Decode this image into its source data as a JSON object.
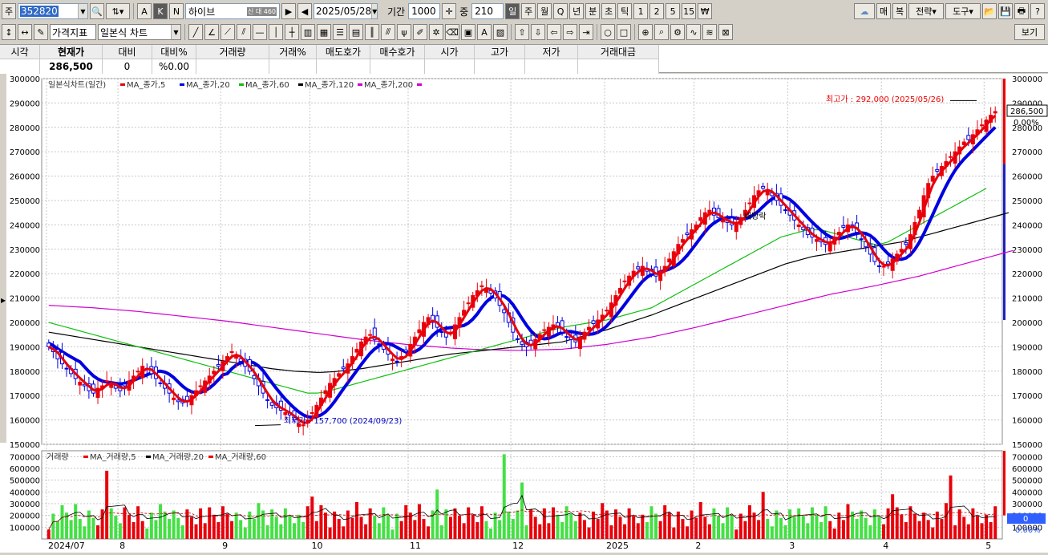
{
  "toolbar1": {
    "market_label": "주",
    "code": "352820",
    "mode_a": "A",
    "mode_k": "K",
    "mode_n": "N",
    "stock_name": "하이브",
    "name_badges": "신 대 460",
    "date": "2025/05/28",
    "period_label": "기간",
    "period_value": "1000",
    "count_label": "중",
    "count_value": "210",
    "periods": [
      "일",
      "주",
      "월",
      "Q",
      "년",
      "분",
      "초",
      "틱",
      "1",
      "2",
      "5",
      "15",
      "₩"
    ],
    "right_buttons": [
      "매",
      "복",
      "전략",
      "도구"
    ],
    "bogi": "보기"
  },
  "toolbar2": {
    "indicator_select": "가격지표",
    "chart_type_select": "일본식 차트"
  },
  "quote": {
    "headers": [
      "시각",
      "현재가",
      "대비",
      "대비%",
      "거래량",
      "거래%",
      "매도호가",
      "매수호가",
      "시가",
      "고가",
      "저가",
      "거래대금"
    ],
    "values": [
      "",
      "286,500",
      "0",
      "%0.00",
      "",
      "",
      "",
      "",
      "",
      "",
      "",
      ""
    ]
  },
  "chart_data": [
    {
      "type": "candlestick",
      "title": "일본식차트(일간)",
      "legend": [
        "MA_종가,5",
        "MA_종가,20",
        "MA_종가,60",
        "MA_종가,120",
        "MA_종가,200"
      ],
      "colors": {
        "up": "#e8000b",
        "down": "#0000e0",
        "ma5": "#e8000b",
        "ma20": "#0000e0",
        "ma60": "#10c010",
        "ma120": "#000000",
        "ma200": "#d000d0"
      },
      "ylim": [
        150000,
        300000
      ],
      "yticks": [
        "150000",
        "160000",
        "170000",
        "180000",
        "190000",
        "200000",
        "210000",
        "220000",
        "230000",
        "240000",
        "250000",
        "260000",
        "270000",
        "280000",
        "290000",
        "300000"
      ],
      "xticks": [
        {
          "label": "2024/07",
          "x": 0
        },
        {
          "label": "8",
          "x": 16
        },
        {
          "label": "9",
          "x": 39
        },
        {
          "label": "10",
          "x": 59
        },
        {
          "label": "11",
          "x": 81
        },
        {
          "label": "12",
          "x": 104
        },
        {
          "label": "2025",
          "x": 125
        },
        {
          "label": "2",
          "x": 145
        },
        {
          "label": "3",
          "x": 166
        },
        {
          "label": "4",
          "x": 187
        },
        {
          "label": "5",
          "x": 210
        }
      ],
      "current_price": "286,500",
      "current_pct": "0.00%",
      "max_label": "최고가 : 292,000 (2025/05/26)",
      "min_label": "최저가 : 157,700 (2024/09/23)",
      "annotation": "배당락",
      "close": [
        190000,
        188000,
        185000,
        183000,
        181000,
        179000,
        177000,
        175500,
        174000,
        172000,
        171000,
        173000,
        174000,
        176000,
        175000,
        173000,
        172000,
        174000,
        176000,
        178000,
        180000,
        182000,
        181000,
        179000,
        177000,
        175000,
        173000,
        171000,
        169000,
        167500,
        167000,
        168000,
        170000,
        172000,
        174000,
        176000,
        178000,
        180000,
        182000,
        184000,
        186000,
        188000,
        186000,
        184000,
        182000,
        180000,
        177000,
        174000,
        171000,
        168000,
        166000,
        165000,
        164000,
        163000,
        162000,
        160000,
        158500,
        158000,
        160000,
        163000,
        166000,
        169000,
        172000,
        175000,
        177000,
        179000,
        181000,
        183000,
        186000,
        189000,
        192000,
        194000,
        195000,
        193000,
        191000,
        189000,
        187000,
        185000,
        184000,
        186000,
        188000,
        191000,
        194000,
        197000,
        200000,
        202000,
        200000,
        198000,
        196000,
        194000,
        196000,
        199000,
        202000,
        205000,
        208000,
        211000,
        213000,
        215000,
        214000,
        212000,
        210000,
        207000,
        204000,
        200000,
        196000,
        193000,
        191000,
        190000,
        191000,
        193000,
        195000,
        197000,
        198000,
        199000,
        198000,
        196000,
        194000,
        193000,
        192000,
        194000,
        196000,
        198000,
        199500,
        201000,
        203000,
        205000,
        208000,
        211000,
        214000,
        217000,
        219000,
        221000,
        222000,
        223000,
        221000,
        220000,
        219000,
        221000,
        223000,
        226000,
        229000,
        232000,
        234000,
        236000,
        238000,
        240000,
        243000,
        245000,
        246000,
        244000,
        243000,
        242000,
        241000,
        240000,
        241000,
        243000,
        246000,
        249000,
        252000,
        254000,
        255000,
        254000,
        252000,
        250000,
        248000,
        246000,
        244000,
        242000,
        240000,
        238000,
        236000,
        235000,
        234000,
        233000,
        232000,
        233000,
        235000,
        237000,
        239000,
        240000,
        239000,
        237000,
        234000,
        231000,
        228000,
        225000,
        223000,
        223000,
        224000,
        226000,
        228000,
        230000,
        232000,
        236000,
        241000,
        246000,
        252000,
        257000,
        260000,
        262000,
        264000,
        266000,
        268000,
        270000,
        272000,
        274000,
        275000,
        277000,
        279000,
        281000,
        283000,
        285000,
        286500
      ],
      "ma60": [
        200000,
        199500,
        199000,
        198500,
        198000,
        197500,
        197000,
        196500,
        196000,
        195500,
        195000,
        194500,
        194000,
        193500,
        193000,
        192500,
        192000,
        191500,
        191000,
        190500,
        190000,
        189500,
        189000,
        188500,
        188000,
        187500,
        187000,
        186500,
        186000,
        185500,
        185000,
        184500,
        184000,
        183500,
        183000,
        182500,
        182000,
        181500,
        181000,
        180500,
        180000,
        179500,
        179000,
        178500,
        178000,
        177500,
        177000,
        176500,
        176000,
        175500,
        175000,
        174500,
        174000,
        173500,
        173000,
        172500,
        172000,
        171500,
        171000,
        171000,
        171000,
        171200,
        171500,
        172000,
        172500,
        173000,
        173500,
        174000,
        174500,
        175000,
        175500,
        176000,
        176500,
        177000,
        177500,
        178000,
        178500,
        179000,
        179500,
        180000,
        180500,
        181000,
        181500,
        182000,
        182500,
        183000,
        183500,
        184000,
        184500,
        185000,
        185500,
        186000,
        186500,
        187000,
        187500,
        188000,
        188500,
        189000,
        189500,
        190000,
        190500,
        191000,
        191500,
        192000,
        192500,
        193000,
        193500,
        194000,
        194500,
        195000,
        195500,
        196000,
        196500,
        197000,
        197500,
        198000,
        198300,
        198600,
        198900,
        199200,
        199500,
        199800,
        200100,
        200400,
        200700,
        201000,
        201500,
        202000,
        202500,
        203000,
        203500,
        204000,
        204500,
        205000,
        205500,
        206000,
        207000,
        208000,
        209000,
        210000,
        211000,
        212000,
        213000,
        214000,
        215000,
        216000,
        217000,
        218000,
        219000,
        220000,
        221000,
        222000,
        223000,
        224000,
        225000,
        226000,
        227000,
        228000,
        229000,
        230000,
        231000,
        232000,
        233000,
        234000,
        235000,
        235500,
        236000,
        236500,
        237000,
        237500,
        238000,
        238000,
        238000,
        238000,
        237500,
        237000,
        236500,
        236000,
        235500,
        235000,
        234500,
        234000,
        233500,
        233000,
        232500,
        232000,
        232000,
        232500,
        233000,
        234000,
        235000,
        236000,
        237000,
        238000,
        239000,
        240000,
        241000,
        242000,
        243000,
        244000,
        245000,
        246000,
        247000,
        248000,
        249000,
        250000,
        251000,
        252000,
        253000,
        254000,
        255000
      ],
      "ma120": [
        196000,
        195700,
        195400,
        195100,
        194800,
        194500,
        194200,
        193900,
        193600,
        193300,
        193000,
        192700,
        192400,
        192100,
        191800,
        191500,
        191200,
        190900,
        190600,
        190300,
        190000,
        189700,
        189400,
        189100,
        188800,
        188500,
        188200,
        187900,
        187600,
        187300,
        187000,
        186700,
        186400,
        186100,
        185800,
        185500,
        185200,
        184900,
        184600,
        184300,
        184000,
        183700,
        183400,
        183100,
        182800,
        182500,
        182200,
        181900,
        181600,
        181300,
        181000,
        180800,
        180600,
        180400,
        180200,
        180000,
        179900,
        179800,
        179700,
        179600,
        179500,
        179500,
        179600,
        179700,
        179800,
        180000,
        180200,
        180400,
        180600,
        180800,
        181000,
        181300,
        181600,
        181900,
        182200,
        182500,
        182800,
        183100,
        183400,
        183700,
        184000,
        184300,
        184600,
        184900,
        185200,
        185500,
        185800,
        186100,
        186400,
        186700,
        187000,
        187200,
        187400,
        187600,
        187800,
        188000,
        188200,
        188400,
        188600,
        188800,
        189000,
        189200,
        189400,
        189600,
        189800,
        190000,
        190200,
        190400,
        190600,
        190800,
        191000,
        191200,
        191400,
        191600,
        191800,
        192000,
        192500,
        193000,
        193500,
        194000,
        194500,
        195000,
        195500,
        196000,
        196500,
        197000,
        197600,
        198200,
        198800,
        199400,
        200000,
        200600,
        201200,
        201800,
        202400,
        203000,
        203700,
        204400,
        205100,
        205800,
        206500,
        207200,
        207900,
        208600,
        209300,
        210000,
        210700,
        211400,
        212100,
        212800,
        213500,
        214200,
        214900,
        215600,
        216300,
        217000,
        217700,
        218400,
        219100,
        219800,
        220500,
        221200,
        221900,
        222600,
        223300,
        224000,
        224500,
        225000,
        225500,
        226000,
        226500,
        227000,
        227300,
        227600,
        227900,
        228200,
        228500,
        228800,
        229100,
        229400,
        229700,
        230000,
        230300,
        230600,
        230900,
        231200,
        231500,
        231800,
        232100,
        232400,
        232700,
        233000,
        233500,
        234000,
        234500,
        235000,
        235500,
        236000,
        236500,
        237000,
        237500,
        238000,
        238500,
        239000,
        239500,
        240000,
        240500,
        241000,
        241500,
        242000,
        242500,
        243000,
        243500,
        244000,
        244500,
        245000
      ],
      "ma200": [
        207000,
        206900,
        206800,
        206700,
        206600,
        206500,
        206400,
        206300,
        206200,
        206100,
        206000,
        205850,
        205700,
        205550,
        205400,
        205250,
        205100,
        204950,
        204800,
        204650,
        204500,
        204300,
        204100,
        203900,
        203700,
        203500,
        203300,
        203100,
        202900,
        202700,
        202500,
        202300,
        202100,
        201900,
        201700,
        201500,
        201300,
        201100,
        200900,
        200700,
        200500,
        200250,
        200000,
        199750,
        199500,
        199250,
        199000,
        198750,
        198500,
        198250,
        198000,
        197750,
        197500,
        197250,
        197000,
        196750,
        196500,
        196250,
        196000,
        195750,
        195500,
        195250,
        195000,
        194750,
        194500,
        194250,
        194000,
        193750,
        193500,
        193250,
        193000,
        192800,
        192600,
        192400,
        192200,
        192000,
        191800,
        191600,
        191400,
        191200,
        191000,
        190850,
        190700,
        190550,
        190400,
        190250,
        190100,
        189950,
        189800,
        189650,
        189500,
        189400,
        189300,
        189200,
        189100,
        189000,
        188950,
        188900,
        188850,
        188800,
        188750,
        188700,
        188650,
        188600,
        188550,
        188500,
        188550,
        188600,
        188650,
        188700,
        188750,
        188800,
        188850,
        188900,
        188950,
        189000,
        189200,
        189400,
        189600,
        189800,
        190000,
        190200,
        190400,
        190600,
        190800,
        191000,
        191300,
        191600,
        191900,
        192200,
        192500,
        192800,
        193100,
        193400,
        193700,
        194000,
        194400,
        194800,
        195200,
        195600,
        196000,
        196400,
        196800,
        197200,
        197600,
        198000,
        198450,
        198900,
        199350,
        199800,
        200250,
        200700,
        201150,
        201600,
        202050,
        202500,
        202950,
        203400,
        203850,
        204300,
        204750,
        205200,
        205650,
        206100,
        206550,
        207000,
        207450,
        207900,
        208350,
        208800,
        209250,
        209700,
        210150,
        210600,
        211050,
        211500,
        211850,
        212200,
        212550,
        212900,
        213250,
        213600,
        213950,
        214300,
        214650,
        215000,
        215400,
        215800,
        216200,
        216600,
        217000,
        217400,
        217800,
        218200,
        218600,
        219000,
        219500,
        220000,
        220500,
        221000,
        221500,
        222000,
        222500,
        223000,
        223500,
        224000,
        224500,
        225000,
        225500,
        226000,
        226500,
        227000,
        227500,
        228000,
        228500,
        229000,
        229500
      ]
    },
    {
      "type": "bar",
      "title": "거래량",
      "legend": [
        "MA_거래량,5",
        "MA_거래량,20",
        "MA_거래량,60"
      ],
      "ylim": [
        0,
        750000
      ],
      "yticks": [
        "100000",
        "200000",
        "300000",
        "400000",
        "500000",
        "600000",
        "700000"
      ],
      "current_value": "0",
      "current_pct": "0.00%",
      "spikes": [
        {
          "i": 13,
          "v": 580000
        },
        {
          "i": 59,
          "v": 360000
        },
        {
          "i": 87,
          "v": 420000
        },
        {
          "i": 102,
          "v": 720000
        },
        {
          "i": 106,
          "v": 480000
        },
        {
          "i": 160,
          "v": 400000
        },
        {
          "i": 202,
          "v": 540000
        },
        {
          "i": 189,
          "v": 380000
        }
      ]
    }
  ]
}
